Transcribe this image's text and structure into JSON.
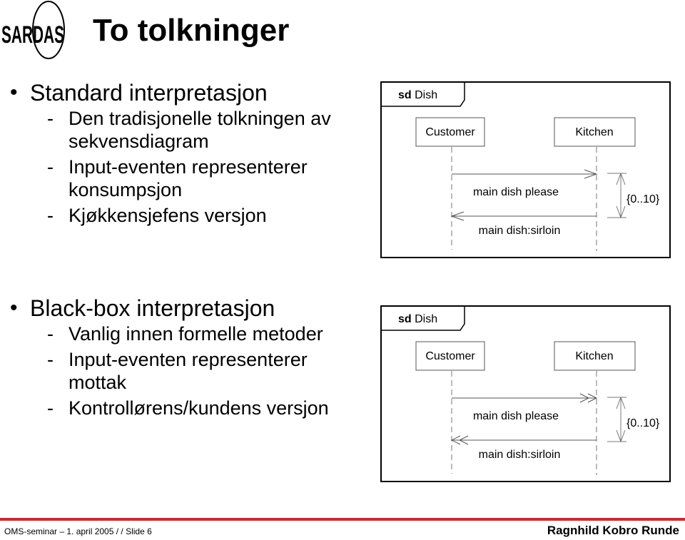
{
  "logo": {
    "text": "SARDAS"
  },
  "title": "To tolkninger",
  "sections": [
    {
      "heading": "Standard interpretasjon",
      "items": [
        "Den tradisjonelle tolkningen av sekvensdiagram",
        "Input-eventen representerer konsumpsjon",
        "Kjøkkensjefens versjon"
      ]
    },
    {
      "heading": "Black-box interpretasjon",
      "items": [
        "Vanlig innen formelle metoder",
        "Input-eventen representerer mottak",
        "Kontrollørens/kundens versjon"
      ]
    }
  ],
  "diagrams": [
    {
      "frame_keyword": "sd",
      "frame_name": "Dish",
      "lifelines": [
        "Customer",
        "Kitchen"
      ],
      "messages": [
        "main dish please",
        "main dish:sirloin"
      ],
      "constraint": "{0..10}",
      "arrow_style": "single"
    },
    {
      "frame_keyword": "sd",
      "frame_name": "Dish",
      "lifelines": [
        "Customer",
        "Kitchen"
      ],
      "messages": [
        "main dish please",
        "main dish:sirloin"
      ],
      "constraint": "{0..10}",
      "arrow_style": "double"
    }
  ],
  "footer": {
    "left": "OMS-seminar – 1. april 2005 /  / Slide 6",
    "right": "Ragnhild Kobro Runde",
    "accent_color": "#d9232a"
  }
}
